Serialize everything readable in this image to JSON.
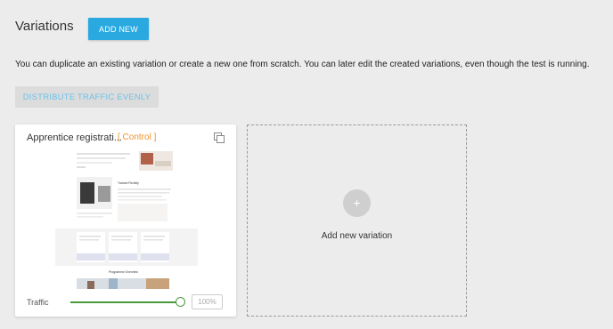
{
  "header": {
    "title": "Variations",
    "add_new_label": "ADD NEW"
  },
  "description": "You can duplicate an existing variation or create a new one from scratch. You can later edit the created variations, even though the test is running.",
  "distribute_label": "DISTRIBUTE TRAFFIC EVENLY",
  "variation_card": {
    "title": "Apprentice registrati...",
    "tag": "[ Control ]",
    "duplicate_icon": "duplicate-icon",
    "traffic_label": "Traffic",
    "traffic_value": "100%",
    "traffic_fraction": 1.0,
    "preview": {
      "section_heading": "Trained Flexibly",
      "overview_heading": "Programme Overview"
    }
  },
  "add_variation": {
    "icon": "plus-icon",
    "label": "Add new variation"
  },
  "colors": {
    "accent": "#29a9e0",
    "control_tag": "#f0922b",
    "slider": "#4a9a3c"
  }
}
